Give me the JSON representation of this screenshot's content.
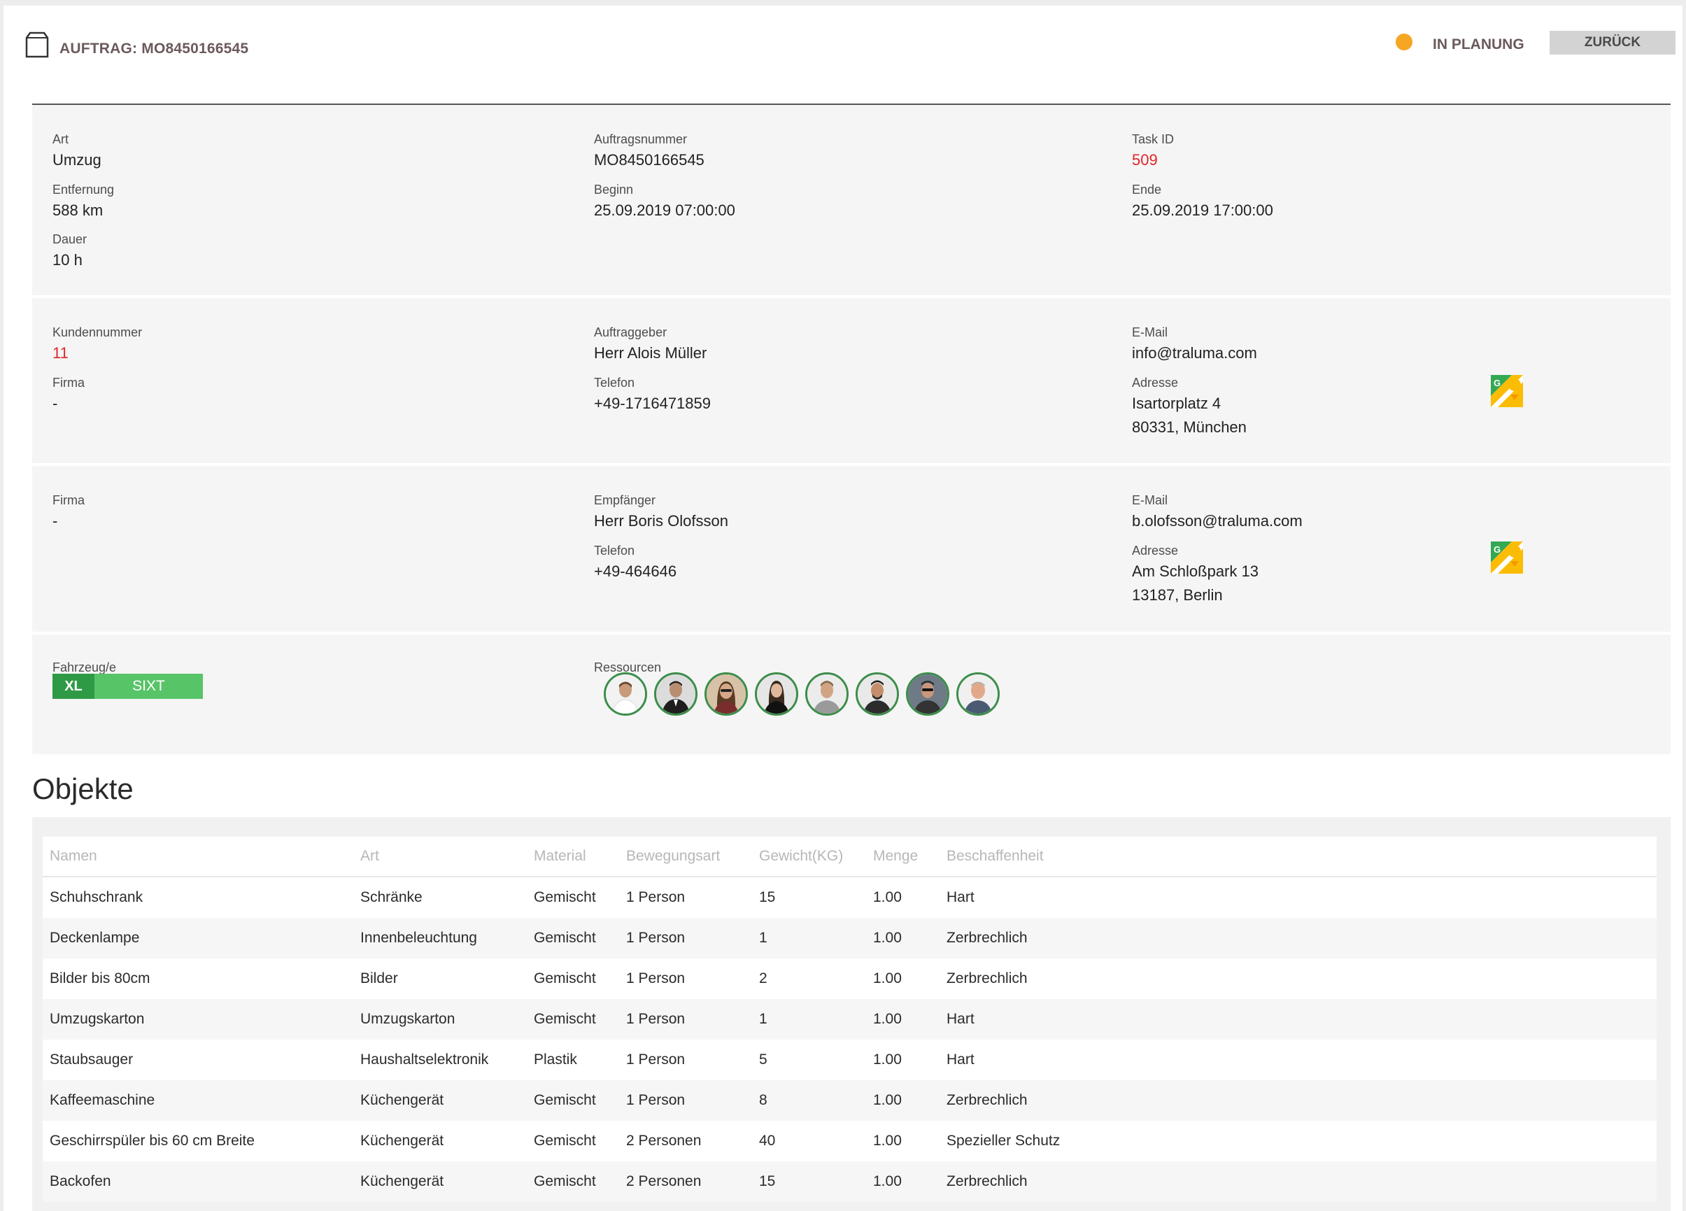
{
  "header": {
    "title": "AUFTRAG: MO8450166545",
    "status": "IN PLANUNG",
    "back_label": "ZURÜCK",
    "status_color": "#f5a623"
  },
  "order": {
    "art_label": "Art",
    "art": "Umzug",
    "entfernung_label": "Entfernung",
    "entfernung": "588 km",
    "dauer_label": "Dauer",
    "dauer": "10 h",
    "auftragsnummer_label": "Auftragsnummer",
    "auftragsnummer": "MO8450166545",
    "beginn_label": "Beginn",
    "beginn": "25.09.2019 07:00:00",
    "task_id_label": "Task ID",
    "task_id": "509",
    "ende_label": "Ende",
    "ende": "25.09.2019 17:00:00"
  },
  "customer": {
    "kundennummer_label": "Kundennummer",
    "kundennummer": "11",
    "firma_label": "Firma",
    "firma": "-",
    "auftraggeber_label": "Auftraggeber",
    "auftraggeber": "Herr Alois Müller",
    "telefon_label": "Telefon",
    "telefon": "+49-1716471859",
    "email_label": "E-Mail",
    "email": "info@traluma.com",
    "adresse_label": "Adresse",
    "adresse_line1": "Isartorplatz 4",
    "adresse_line2": "80331, München"
  },
  "recipient": {
    "firma_label": "Firma",
    "firma": "-",
    "empfaenger_label": "Empfänger",
    "empfaenger": "Herr Boris Olofsson",
    "telefon_label": "Telefon",
    "telefon": "+49-464646",
    "email_label": "E-Mail",
    "email": "b.olofsson@traluma.com",
    "adresse_label": "Adresse",
    "adresse_line1": "Am Schloßpark 13",
    "adresse_line2": "13187, Berlin"
  },
  "resources_section": {
    "fahrzeug_label": "Fahrzeug/e",
    "vehicle_size": "XL",
    "vehicle_name": "SIXT",
    "ressourcen_label": "Ressourcen",
    "avatar_count": 8
  },
  "objekte": {
    "title": "Objekte",
    "columns": [
      "Namen",
      "Art",
      "Material",
      "Bewegungsart",
      "Gewicht(KG)",
      "Menge",
      "Beschaffenheit"
    ],
    "rows": [
      [
        "Schuhschrank",
        "Schränke",
        "Gemischt",
        "1 Person",
        "15",
        "1.00",
        "Hart"
      ],
      [
        "Deckenlampe",
        "Innenbeleuchtung",
        "Gemischt",
        "1 Person",
        "1",
        "1.00",
        "Zerbrechlich"
      ],
      [
        "Bilder bis 80cm",
        "Bilder",
        "Gemischt",
        "1 Person",
        "2",
        "1.00",
        "Zerbrechlich"
      ],
      [
        "Umzugskarton",
        "Umzugskarton",
        "Gemischt",
        "1 Person",
        "1",
        "1.00",
        "Hart"
      ],
      [
        "Staubsauger",
        "Haushaltselektronik",
        "Plastik",
        "1 Person",
        "5",
        "1.00",
        "Hart"
      ],
      [
        "Kaffeemaschine",
        "Küchengerät",
        "Gemischt",
        "1 Person",
        "8",
        "1.00",
        "Zerbrechlich"
      ],
      [
        "Geschirrspüler bis 60 cm Breite",
        "Küchengerät",
        "Gemischt",
        "2 Personen",
        "40",
        "1.00",
        "Spezieller Schutz"
      ],
      [
        "Backofen",
        "Küchengerät",
        "Gemischt",
        "2 Personen",
        "15",
        "1.00",
        "Zerbrechlich"
      ]
    ]
  }
}
